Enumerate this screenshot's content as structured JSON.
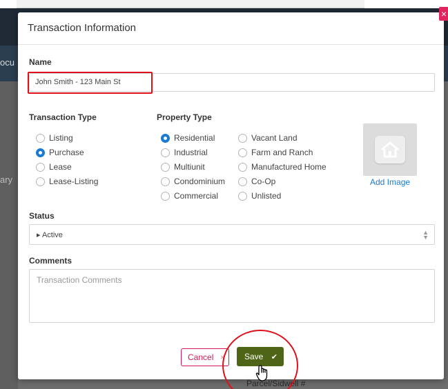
{
  "background": {
    "fragments": [
      "ocu",
      "ary"
    ],
    "bottom_label": "Parcel/Sidwell #"
  },
  "modal": {
    "title": "Transaction Information",
    "close_glyph": "×"
  },
  "form": {
    "name_label": "Name",
    "name_value": "John Smith - 123 Main St",
    "transaction_type_label": "Transaction Type",
    "transaction_types": [
      {
        "label": "Listing",
        "checked": false
      },
      {
        "label": "Purchase",
        "checked": true
      },
      {
        "label": "Lease",
        "checked": false
      },
      {
        "label": "Lease-Listing",
        "checked": false
      }
    ],
    "property_type_label": "Property Type",
    "property_types_col1": [
      {
        "label": "Residential",
        "checked": true
      },
      {
        "label": "Industrial",
        "checked": false
      },
      {
        "label": "Multiunit",
        "checked": false
      },
      {
        "label": "Condominium",
        "checked": false
      },
      {
        "label": "Commercial",
        "checked": false
      }
    ],
    "property_types_col2": [
      {
        "label": "Vacant Land",
        "checked": false
      },
      {
        "label": "Farm and Ranch",
        "checked": false
      },
      {
        "label": "Manufactured Home",
        "checked": false
      },
      {
        "label": "Co-Op",
        "checked": false
      },
      {
        "label": "Unlisted",
        "checked": false
      }
    ],
    "add_image_label": "Add Image",
    "status_label": "Status",
    "status_value": "▸ Active",
    "comments_label": "Comments",
    "comments_placeholder": "Transaction Comments"
  },
  "actions": {
    "cancel_label": "Cancel",
    "save_label": "Save",
    "save_check": "✔"
  },
  "colors": {
    "accent_blue": "#1a7ad4",
    "save_green": "#4e6417",
    "cancel_pink": "#d0185a",
    "highlight_red": "#e0101a"
  }
}
